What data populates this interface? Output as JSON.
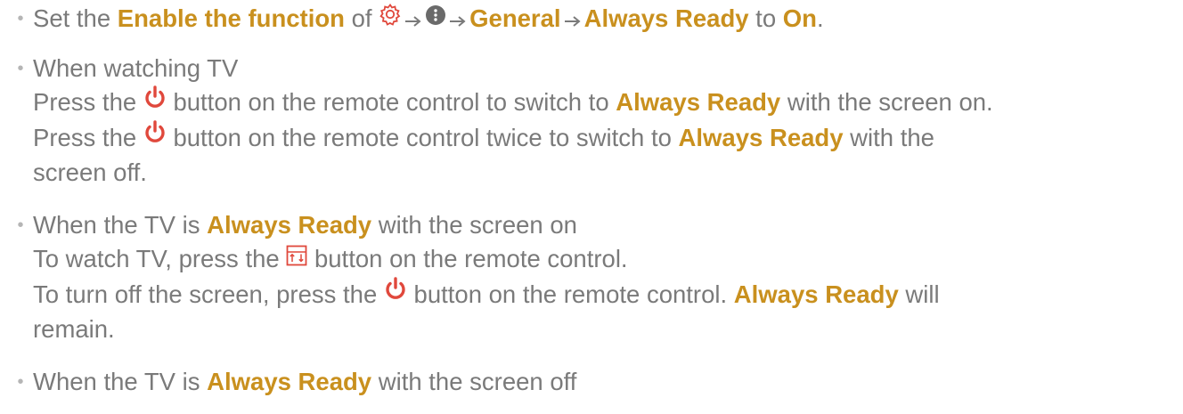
{
  "bullets": [
    {
      "segments": [
        {
          "t": "text",
          "v": "Set the "
        },
        {
          "t": "bold",
          "v": "Enable the function"
        },
        {
          "t": "text",
          "v": " of "
        },
        {
          "t": "icon",
          "icon": "settings-gear-icon"
        },
        {
          "t": "arrow"
        },
        {
          "t": "icon",
          "icon": "more-options-icon"
        },
        {
          "t": "arrow"
        },
        {
          "t": "bold",
          "v": "General"
        },
        {
          "t": "arrow"
        },
        {
          "t": "bold",
          "v": "Always Ready"
        },
        {
          "t": "text",
          "v": " to "
        },
        {
          "t": "bold",
          "v": "On"
        },
        {
          "t": "text",
          "v": "."
        }
      ]
    },
    {
      "lines": [
        [
          {
            "t": "text",
            "v": "When watching TV"
          }
        ],
        [
          {
            "t": "text",
            "v": "Press the "
          },
          {
            "t": "icon",
            "icon": "power-icon"
          },
          {
            "t": "text",
            "v": " button on the remote control to switch to "
          },
          {
            "t": "bold",
            "v": "Always Ready"
          },
          {
            "t": "text",
            "v": " with the screen on."
          }
        ],
        [
          {
            "t": "text",
            "v": "Press the "
          },
          {
            "t": "icon",
            "icon": "power-icon"
          },
          {
            "t": "text",
            "v": " button on the remote control twice to switch to "
          },
          {
            "t": "bold",
            "v": "Always Ready"
          },
          {
            "t": "text",
            "v": " with the"
          }
        ],
        [
          {
            "t": "text",
            "v": "screen off."
          }
        ]
      ]
    },
    {
      "lines": [
        [
          {
            "t": "text",
            "v": "When the TV is "
          },
          {
            "t": "bold",
            "v": "Always Ready"
          },
          {
            "t": "text",
            "v": " with the screen on"
          }
        ],
        [
          {
            "t": "text",
            "v": "To watch TV, press the "
          },
          {
            "t": "icon",
            "icon": "input-source-icon"
          },
          {
            "t": "text",
            "v": " button on the remote control."
          }
        ],
        [
          {
            "t": "text",
            "v": "To turn off the screen, press the "
          },
          {
            "t": "icon",
            "icon": "power-icon"
          },
          {
            "t": "text",
            "v": " button on the remote control. "
          },
          {
            "t": "bold",
            "v": "Always Ready"
          },
          {
            "t": "text",
            "v": " will"
          }
        ],
        [
          {
            "t": "text",
            "v": "remain."
          }
        ]
      ]
    },
    {
      "lines": [
        [
          {
            "t": "text",
            "v": "When the TV is "
          },
          {
            "t": "bold",
            "v": "Always Ready"
          },
          {
            "t": "text",
            "v": " with the screen off"
          }
        ]
      ]
    }
  ],
  "colors": {
    "body_text": "#7a7a7a",
    "highlight": "#c9901e",
    "power_icon": "#e0483c",
    "gear_icon": "#e0483c",
    "arrow": "#7a7a7a"
  }
}
